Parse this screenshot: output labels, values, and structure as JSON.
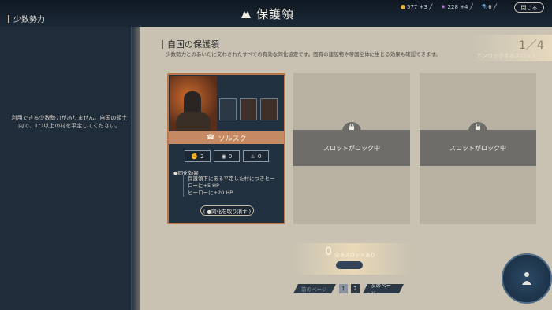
{
  "header": {
    "title": "保護領",
    "close_label": "閉じる",
    "resources": [
      {
        "name": "gold",
        "icon": "coin-icon",
        "color": "#e0b64a",
        "value": "577 +3 ╱"
      },
      {
        "name": "influence",
        "icon": "star-icon",
        "color": "#b478e0",
        "value": "228 +4 ╱"
      },
      {
        "name": "science",
        "icon": "flask-icon",
        "color": "#5ea3e0",
        "value": "6 ╱"
      }
    ]
  },
  "sidebar": {
    "title": "少数勢力",
    "empty_message": "利用できる少数勢力がありません。自国の領土内で、1つ以上の村を平定してください。"
  },
  "main": {
    "title": "自国の保護領",
    "subtitle": "少数勢力とのあいだに交わされたすべての有効な同化協定です。固有の建設物や帝国全体に生じる効果も確認できます。",
    "counter": "1／4",
    "counter_sub": "アンロックするスロット"
  },
  "card": {
    "faction_name": "ソルスク",
    "stats": [
      {
        "icon": "fist-icon",
        "value": "2"
      },
      {
        "icon": "eye-icon",
        "value": "0"
      },
      {
        "icon": "flame-icon",
        "value": "0"
      }
    ],
    "effect_title": "●同化効果",
    "effects": [
      "保護領下にある平定した村につきヒーローに+5 HP",
      "ヒーローに+20 HP"
    ],
    "revoke_label": "( ●同化を取り消す )"
  },
  "slots": [
    {
      "label": "スロットがロック中"
    },
    {
      "label": "スロットがロック中"
    }
  ],
  "empty_slots": {
    "count": "0",
    "label": "空きスロットあり"
  },
  "pager": {
    "prev_label": "前のページ",
    "pages": [
      "1",
      "2"
    ],
    "current": "1",
    "next_label": "次のページ"
  },
  "colors": {
    "accent": "#c58a63",
    "locked": "#6e6d69",
    "page": "#c9c2b3",
    "dark": "#223140"
  }
}
